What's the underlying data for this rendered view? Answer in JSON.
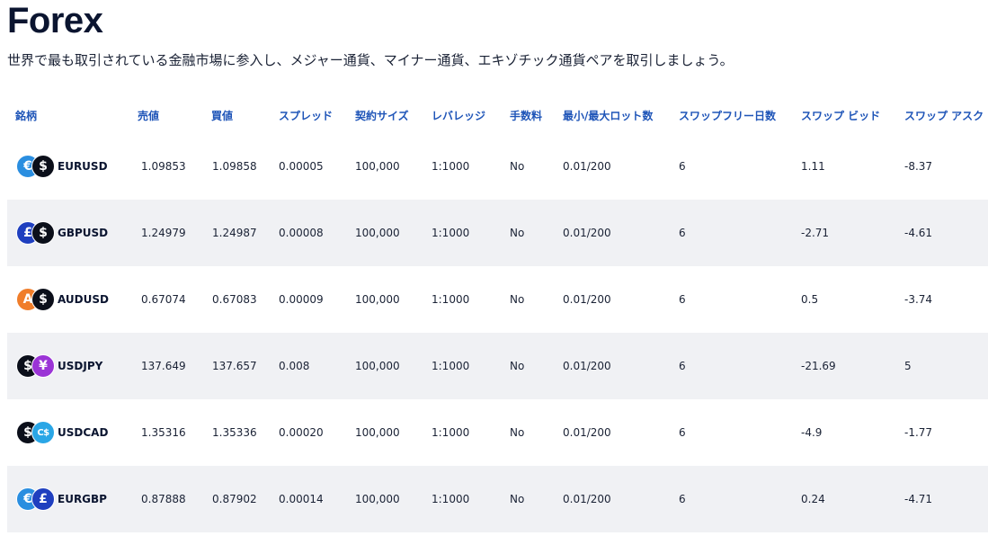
{
  "page": {
    "title": "Forex",
    "subtitle": "世界で最も取引されている金融市場に参入し、メジャー通貨、マイナー通貨、エキゾチック通貨ペアを取引しましょう。"
  },
  "table": {
    "headers": [
      "銘柄",
      "売値",
      "買値",
      "スプレッド",
      "契約サイズ",
      "レバレッジ",
      "手数料",
      "最小/最大ロット数",
      "スワップフリー日数",
      "スワップ ビッド",
      "スワップ アスク"
    ],
    "rows": [
      {
        "symbol": "EURUSD",
        "sell": "1.09853",
        "buy": "1.09858",
        "spread": "0.00005",
        "contract": "100,000",
        "leverage": "1:1000",
        "fee": "No",
        "lots": "0.01/200",
        "swap_free_days": "6",
        "swap_bid": "1.11",
        "swap_ask": "-8.37",
        "icons": [
          {
            "name": "euro-icon",
            "glyph": "€",
            "color": "#2a8ee0"
          },
          {
            "name": "dollar-icon",
            "glyph": "$",
            "color": "#0b0f1a"
          }
        ]
      },
      {
        "symbol": "GBPUSD",
        "sell": "1.24979",
        "buy": "1.24987",
        "spread": "0.00008",
        "contract": "100,000",
        "leverage": "1:1000",
        "fee": "No",
        "lots": "0.01/200",
        "swap_free_days": "6",
        "swap_bid": "-2.71",
        "swap_ask": "-4.61",
        "icons": [
          {
            "name": "pound-icon",
            "glyph": "£",
            "color": "#1f3fbf"
          },
          {
            "name": "dollar-icon",
            "glyph": "$",
            "color": "#0b0f1a"
          }
        ]
      },
      {
        "symbol": "AUDUSD",
        "sell": "0.67074",
        "buy": "0.67083",
        "spread": "0.00009",
        "contract": "100,000",
        "leverage": "1:1000",
        "fee": "No",
        "lots": "0.01/200",
        "swap_free_days": "6",
        "swap_bid": "0.5",
        "swap_ask": "-3.74",
        "icons": [
          {
            "name": "australian-dollar-icon",
            "glyph": "A",
            "color": "#f07d2a"
          },
          {
            "name": "dollar-icon",
            "glyph": "$",
            "color": "#0b0f1a"
          }
        ]
      },
      {
        "symbol": "USDJPY",
        "sell": "137.649",
        "buy": "137.657",
        "spread": "0.008",
        "contract": "100,000",
        "leverage": "1:1000",
        "fee": "No",
        "lots": "0.01/200",
        "swap_free_days": "6",
        "swap_bid": "-21.69",
        "swap_ask": "5",
        "icons": [
          {
            "name": "dollar-icon",
            "glyph": "$",
            "color": "#0b0f1a"
          },
          {
            "name": "yen-icon",
            "glyph": "¥",
            "color": "#9b34d6"
          }
        ]
      },
      {
        "symbol": "USDCAD",
        "sell": "1.35316",
        "buy": "1.35336",
        "spread": "0.00020",
        "contract": "100,000",
        "leverage": "1:1000",
        "fee": "No",
        "lots": "0.01/200",
        "swap_free_days": "6",
        "swap_bid": "-4.9",
        "swap_ask": "-1.77",
        "icons": [
          {
            "name": "dollar-icon",
            "glyph": "$",
            "color": "#0b0f1a"
          },
          {
            "name": "canadian-dollar-icon",
            "glyph": "C$",
            "color": "#2aa6e6"
          }
        ]
      },
      {
        "symbol": "EURGBP",
        "sell": "0.87888",
        "buy": "0.87902",
        "spread": "0.00014",
        "contract": "100,000",
        "leverage": "1:1000",
        "fee": "No",
        "lots": "0.01/200",
        "swap_free_days": "6",
        "swap_bid": "0.24",
        "swap_ask": "-4.71",
        "icons": [
          {
            "name": "euro-icon",
            "glyph": "€",
            "color": "#2a8ee0"
          },
          {
            "name": "pound-icon",
            "glyph": "£",
            "color": "#1f3fbf"
          }
        ]
      }
    ]
  }
}
